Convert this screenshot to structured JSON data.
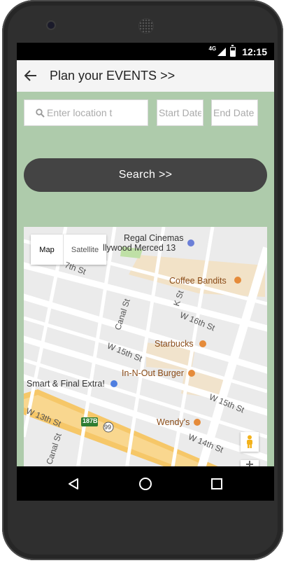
{
  "status": {
    "network": "4G",
    "time": "12:15"
  },
  "appbar": {
    "title": "Plan your EVENTS >>"
  },
  "form": {
    "location_placeholder": "Enter location t",
    "start_placeholder": "Start Date",
    "end_placeholder": "End Date",
    "search_label": "Search >>"
  },
  "map": {
    "type_map_label": "Map",
    "type_satellite_label": "Satellite",
    "pois": {
      "regal": "Regal Cinemas",
      "regal_sub": "llywood Merced 13",
      "coffee": "Coffee Bandits",
      "starbucks": "Starbucks",
      "innout": "In-N-Out Burger",
      "smartfinal": "Smart & Final Extra!",
      "wendys": "Wendy's"
    },
    "streets": {
      "w17": "7th St",
      "kst": "K St",
      "w16": "W 16th St",
      "canal1": "Canal St",
      "w15a": "W 15th St",
      "w15b": "W 15th St",
      "w14": "W 14th St",
      "w13": "W 13th St",
      "canal2": "Canal St",
      "hwy_187b": "187B",
      "hwy_99": "99"
    }
  },
  "colors": {
    "screen_bg": "#aecbab",
    "search_button": "#444444",
    "appbar": "#f4f4f4"
  }
}
